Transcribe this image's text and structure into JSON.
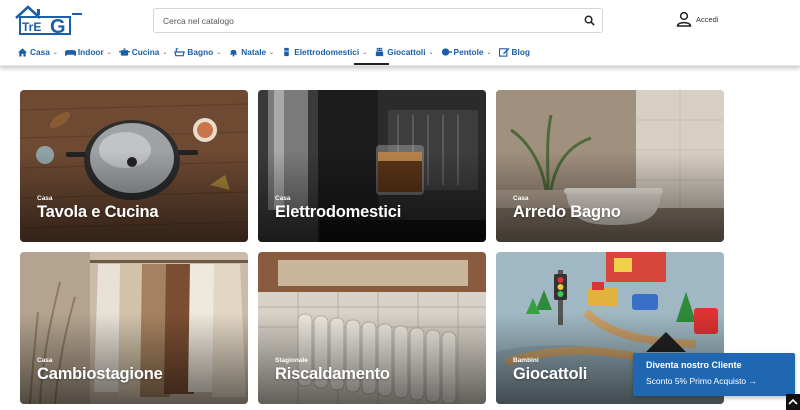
{
  "brand": {
    "logo_text": "TreG"
  },
  "search": {
    "placeholder": "Cerca nel catalogo"
  },
  "account": {
    "login_label": "Accedi"
  },
  "nav": {
    "items": [
      {
        "label": "Casa",
        "icon": "home-icon",
        "dropdown": true
      },
      {
        "label": "Indoor",
        "icon": "sofa-icon",
        "dropdown": true
      },
      {
        "label": "Cucina",
        "icon": "pot-icon",
        "dropdown": true
      },
      {
        "label": "Bagno",
        "icon": "bathtub-icon",
        "dropdown": true
      },
      {
        "label": "Natale",
        "icon": "bell-icon",
        "dropdown": true
      },
      {
        "label": "Elettrodomestici",
        "icon": "appliance-icon",
        "dropdown": true
      },
      {
        "label": "Giocattoli",
        "icon": "toy-icon",
        "dropdown": true
      },
      {
        "label": "Pentole",
        "icon": "pan-icon",
        "dropdown": true
      },
      {
        "label": "Blog",
        "icon": "edit-icon",
        "dropdown": false
      }
    ],
    "active": "Giocattoli"
  },
  "categories": [
    {
      "kicker": "Casa",
      "title": "Tavola e Cucina"
    },
    {
      "kicker": "Casa",
      "title": "Elettrodomestici"
    },
    {
      "kicker": "Casa",
      "title": "Arredo Bagno"
    },
    {
      "kicker": "Casa",
      "title": "Cambiostagione"
    },
    {
      "kicker": "Stagionale",
      "title": "Riscaldamento"
    },
    {
      "kicker": "Bambini",
      "title": "Giocattoli"
    }
  ],
  "promo": {
    "line1": "Diventa nostro Cliente",
    "line2": "Sconto 5% Primo Acquisto →"
  },
  "colors": {
    "brand_blue": "#1b5fa8",
    "promo_blue": "#1f67b1"
  }
}
